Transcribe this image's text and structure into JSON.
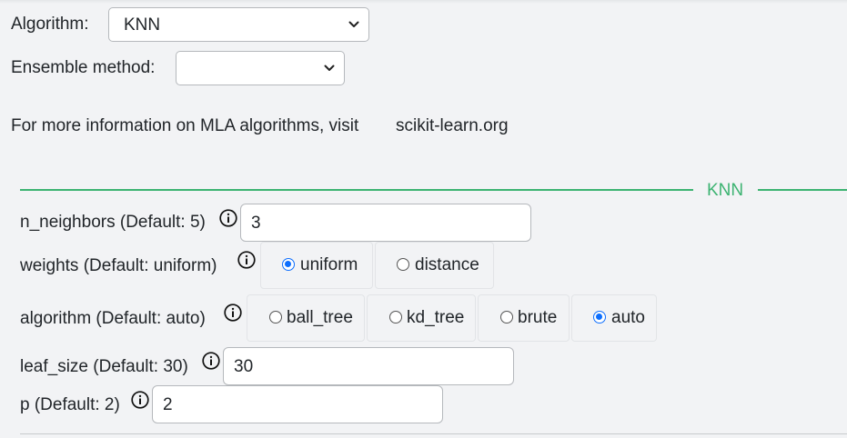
{
  "form": {
    "algorithm_label": "Algorithm:",
    "algorithm_value": "KNN",
    "ensemble_label": "Ensemble method:",
    "ensemble_value": "",
    "info_text": "For more information on MLA algorithms, visit",
    "info_link": "scikit-learn.org"
  },
  "section": {
    "title": "KNN",
    "accent_color": "#3cb371"
  },
  "params": {
    "n_neighbors": {
      "label": "n_neighbors (Default: 5)",
      "value": "3"
    },
    "weights": {
      "label": "weights (Default: uniform)",
      "options": [
        "uniform",
        "distance"
      ],
      "selected": "uniform"
    },
    "algorithm": {
      "label": "algorithm (Default: auto)",
      "options": [
        "ball_tree",
        "kd_tree",
        "brute",
        "auto"
      ],
      "selected": "auto"
    },
    "leaf_size": {
      "label": "leaf_size (Default: 30)",
      "value": "30"
    },
    "p": {
      "label": "p (Default: 2)",
      "value": "2"
    }
  },
  "icons": {
    "info": "info-circle-icon",
    "dropdown": "chevron-down-icon",
    "radio_selected_color": "#0d6efd"
  }
}
